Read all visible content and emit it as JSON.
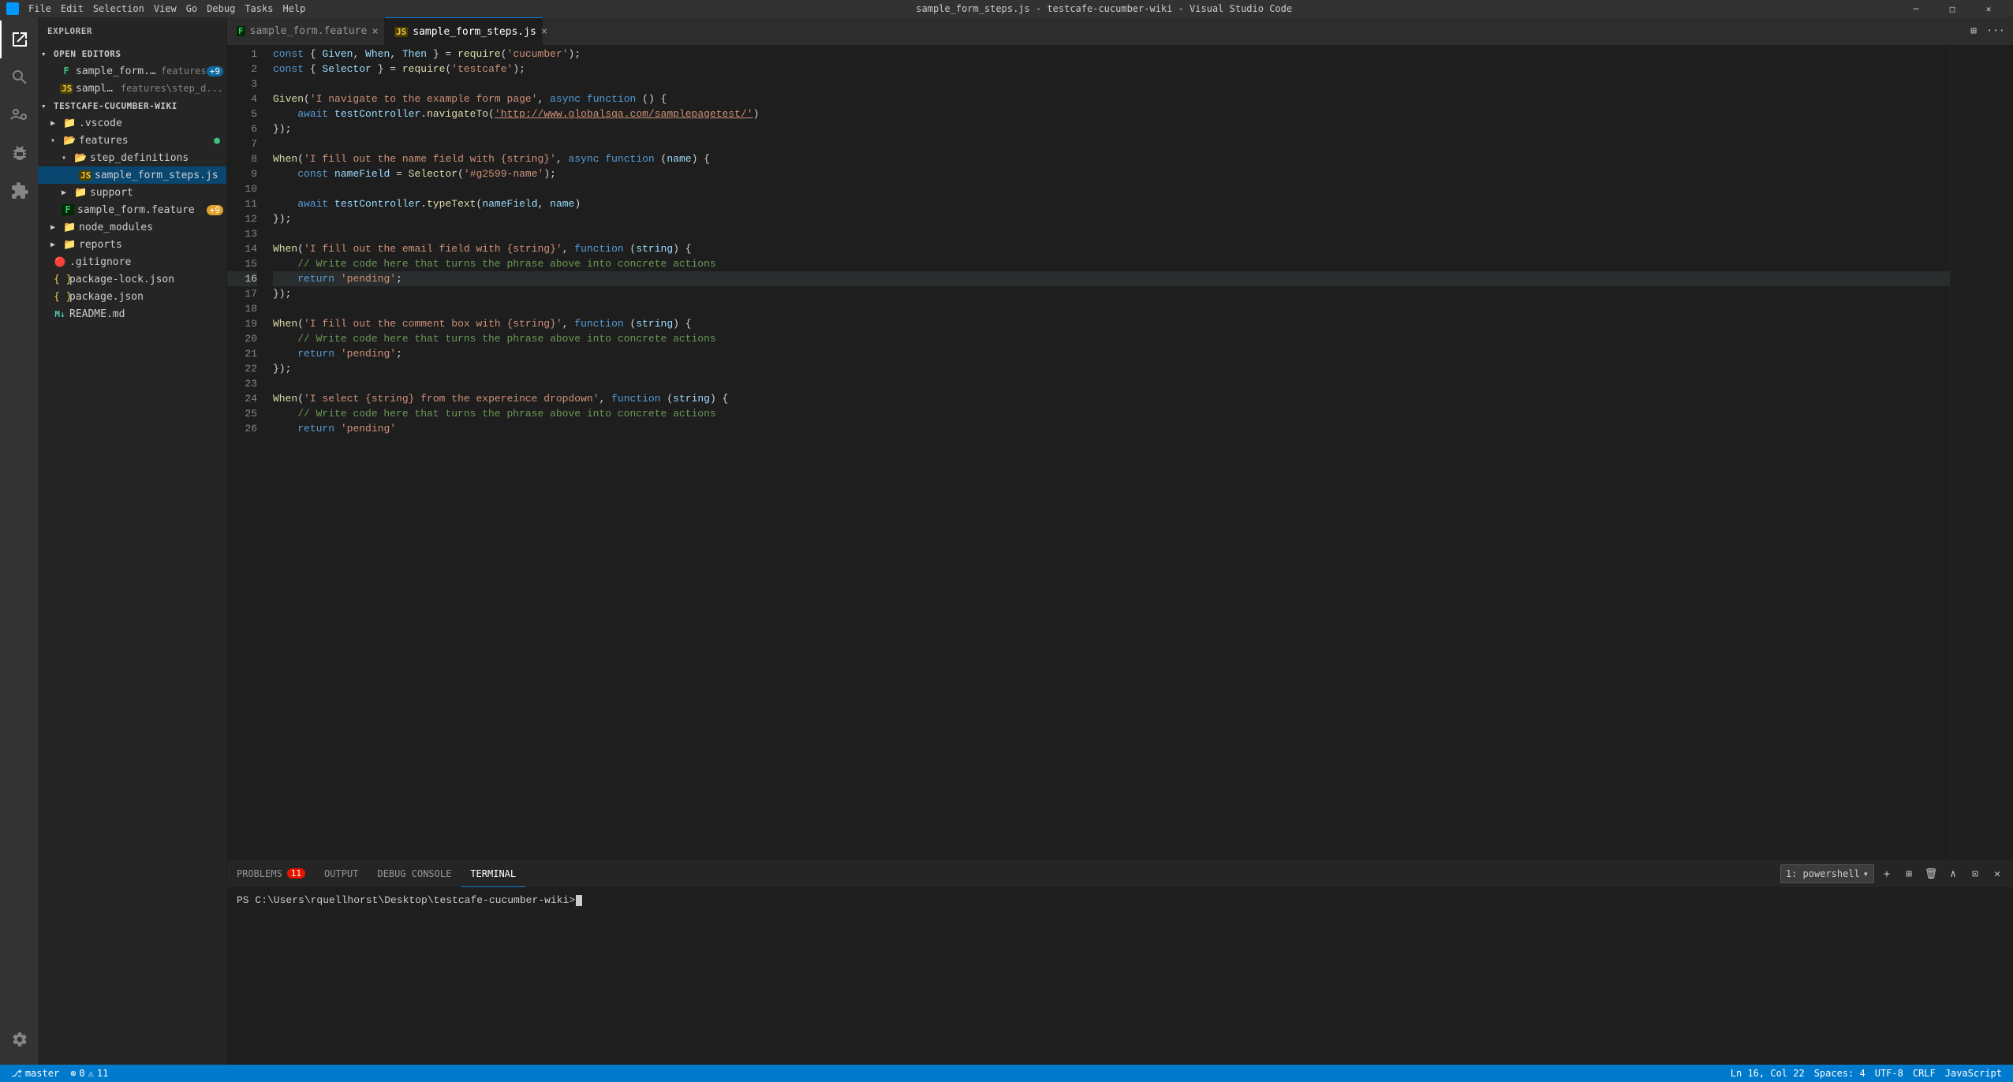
{
  "titlebar": {
    "title": "sample_form_steps.js - testcafe-cucumber-wiki - Visual Studio Code",
    "minimize": "─",
    "maximize": "□",
    "close": "✕"
  },
  "menubar": {
    "items": [
      "File",
      "Edit",
      "Selection",
      "View",
      "Go",
      "Debug",
      "Tasks",
      "Help"
    ]
  },
  "sidebar": {
    "title": "Explorer",
    "sections": {
      "open_editors": {
        "label": "Open Editors",
        "items": [
          {
            "name": "sample_form.feature",
            "icon": "feature",
            "color": "#3dc27a",
            "badge": "+9",
            "extra": "features"
          },
          {
            "name": "sample_form_steps.js",
            "icon": "js",
            "color": "#e8c84e",
            "extra": "features\\step_d..."
          }
        ]
      },
      "project": {
        "label": "TESTCAFE-CUCUMBER-WIKI",
        "items": [
          {
            "type": "folder",
            "name": ".vscode",
            "indent": 1,
            "color": "#e2b040"
          },
          {
            "type": "folder",
            "name": "features",
            "indent": 1,
            "color": "#3dc27a",
            "badge": "●"
          },
          {
            "type": "folder",
            "name": "step_definitions",
            "indent": 2,
            "color": ""
          },
          {
            "type": "file",
            "name": "sample_form_steps.js",
            "indent": 3,
            "color": "#e8c84e",
            "selected": true
          },
          {
            "type": "folder",
            "name": "support",
            "indent": 2,
            "color": ""
          },
          {
            "type": "file",
            "name": "sample_form.feature",
            "indent": 2,
            "color": "#3dc27a",
            "badge": "+9"
          },
          {
            "type": "folder",
            "name": "node_modules",
            "indent": 1,
            "color": ""
          },
          {
            "type": "folder",
            "name": "reports",
            "indent": 1,
            "color": ""
          },
          {
            "type": "file",
            "name": ".gitignore",
            "indent": 1,
            "color": "#e05252"
          },
          {
            "type": "file",
            "name": "package-lock.json",
            "indent": 1,
            "color": ""
          },
          {
            "type": "file",
            "name": "package.json",
            "indent": 1,
            "color": ""
          },
          {
            "type": "file",
            "name": "README.md",
            "indent": 1,
            "color": ""
          }
        ]
      }
    }
  },
  "tabs": [
    {
      "name": "sample_form.feature",
      "icon": "feature",
      "active": false,
      "modified": false
    },
    {
      "name": "sample_form_steps.js",
      "icon": "js",
      "active": true,
      "modified": false
    }
  ],
  "code": {
    "lines": [
      {
        "num": 1,
        "tokens": [
          {
            "t": "kw",
            "v": "const"
          },
          {
            "t": "plain",
            "v": " { "
          },
          {
            "t": "var",
            "v": "Given"
          },
          {
            "t": "plain",
            "v": ", "
          },
          {
            "t": "var",
            "v": "When"
          },
          {
            "t": "plain",
            "v": ", "
          },
          {
            "t": "var",
            "v": "Then"
          },
          {
            "t": "plain",
            "v": " } = "
          },
          {
            "t": "fn",
            "v": "require"
          },
          {
            "t": "plain",
            "v": "("
          },
          {
            "t": "str",
            "v": "'cucumber'"
          },
          {
            "t": "plain",
            "v": ");"
          }
        ]
      },
      {
        "num": 2,
        "tokens": [
          {
            "t": "kw",
            "v": "const"
          },
          {
            "t": "plain",
            "v": " { "
          },
          {
            "t": "var",
            "v": "Selector"
          },
          {
            "t": "plain",
            "v": " } = "
          },
          {
            "t": "fn",
            "v": "require"
          },
          {
            "t": "plain",
            "v": "("
          },
          {
            "t": "str",
            "v": "'testcafe'"
          },
          {
            "t": "plain",
            "v": ");"
          }
        ]
      },
      {
        "num": 3,
        "tokens": []
      },
      {
        "num": 4,
        "tokens": [
          {
            "t": "fn",
            "v": "Given"
          },
          {
            "t": "plain",
            "v": "("
          },
          {
            "t": "str",
            "v": "'I navigate to the example form page'"
          },
          {
            "t": "plain",
            "v": ", "
          },
          {
            "t": "kw",
            "v": "async"
          },
          {
            "t": "plain",
            "v": " "
          },
          {
            "t": "kw",
            "v": "function"
          },
          {
            "t": "plain",
            "v": " () {"
          }
        ]
      },
      {
        "num": 5,
        "tokens": [
          {
            "t": "plain",
            "v": "    "
          },
          {
            "t": "kw",
            "v": "await"
          },
          {
            "t": "plain",
            "v": " "
          },
          {
            "t": "var",
            "v": "testController"
          },
          {
            "t": "plain",
            "v": "."
          },
          {
            "t": "fn",
            "v": "navigateTo"
          },
          {
            "t": "plain",
            "v": "("
          },
          {
            "t": "url",
            "v": "'http://www.globalsqa.com/samplepagetest/'"
          },
          {
            "t": "plain",
            "v": ")"
          }
        ]
      },
      {
        "num": 6,
        "tokens": [
          {
            "t": "plain",
            "v": "});"
          }
        ]
      },
      {
        "num": 7,
        "tokens": []
      },
      {
        "num": 8,
        "tokens": [
          {
            "t": "fn",
            "v": "When"
          },
          {
            "t": "plain",
            "v": "("
          },
          {
            "t": "str",
            "v": "'I fill out the name field with {string}'"
          },
          {
            "t": "plain",
            "v": ", "
          },
          {
            "t": "kw",
            "v": "async"
          },
          {
            "t": "plain",
            "v": " "
          },
          {
            "t": "kw",
            "v": "function"
          },
          {
            "t": "plain",
            "v": " ("
          },
          {
            "t": "var",
            "v": "name"
          },
          {
            "t": "plain",
            "v": ") {"
          }
        ]
      },
      {
        "num": 9,
        "tokens": [
          {
            "t": "plain",
            "v": "    "
          },
          {
            "t": "kw",
            "v": "const"
          },
          {
            "t": "plain",
            "v": " "
          },
          {
            "t": "var",
            "v": "nameField"
          },
          {
            "t": "plain",
            "v": " = "
          },
          {
            "t": "fn",
            "v": "Selector"
          },
          {
            "t": "plain",
            "v": "("
          },
          {
            "t": "str",
            "v": "'#g2599-name'"
          },
          {
            "t": "plain",
            "v": ");"
          }
        ]
      },
      {
        "num": 10,
        "tokens": []
      },
      {
        "num": 11,
        "tokens": [
          {
            "t": "plain",
            "v": "    "
          },
          {
            "t": "kw",
            "v": "await"
          },
          {
            "t": "plain",
            "v": " "
          },
          {
            "t": "var",
            "v": "testController"
          },
          {
            "t": "plain",
            "v": "."
          },
          {
            "t": "fn",
            "v": "typeText"
          },
          {
            "t": "plain",
            "v": "("
          },
          {
            "t": "var",
            "v": "nameField"
          },
          {
            "t": "plain",
            "v": ", "
          },
          {
            "t": "var",
            "v": "name"
          },
          {
            "t": "plain",
            "v": ")"
          }
        ]
      },
      {
        "num": 12,
        "tokens": [
          {
            "t": "plain",
            "v": "});"
          }
        ]
      },
      {
        "num": 13,
        "tokens": []
      },
      {
        "num": 14,
        "tokens": [
          {
            "t": "fn",
            "v": "When"
          },
          {
            "t": "plain",
            "v": "("
          },
          {
            "t": "str",
            "v": "'I fill out the email field with {string}'"
          },
          {
            "t": "plain",
            "v": ", "
          },
          {
            "t": "kw",
            "v": "function"
          },
          {
            "t": "plain",
            "v": " ("
          },
          {
            "t": "var",
            "v": "string"
          },
          {
            "t": "plain",
            "v": ") {"
          }
        ]
      },
      {
        "num": 15,
        "tokens": [
          {
            "t": "plain",
            "v": "    "
          },
          {
            "t": "cm",
            "v": "// Write code here that turns the phrase above into concrete actions"
          }
        ]
      },
      {
        "num": 16,
        "tokens": [
          {
            "t": "plain",
            "v": "    "
          },
          {
            "t": "kw",
            "v": "return"
          },
          {
            "t": "plain",
            "v": " "
          },
          {
            "t": "str",
            "v": "'pending'"
          },
          {
            "t": "plain",
            "v": ";"
          }
        ],
        "highlighted": true
      },
      {
        "num": 17,
        "tokens": [
          {
            "t": "plain",
            "v": "});"
          }
        ]
      },
      {
        "num": 18,
        "tokens": []
      },
      {
        "num": 19,
        "tokens": [
          {
            "t": "fn",
            "v": "When"
          },
          {
            "t": "plain",
            "v": "("
          },
          {
            "t": "str",
            "v": "'I fill out the comment box with {string}'"
          },
          {
            "t": "plain",
            "v": ", "
          },
          {
            "t": "kw",
            "v": "function"
          },
          {
            "t": "plain",
            "v": " ("
          },
          {
            "t": "var",
            "v": "string"
          },
          {
            "t": "plain",
            "v": ") {"
          }
        ]
      },
      {
        "num": 20,
        "tokens": [
          {
            "t": "plain",
            "v": "    "
          },
          {
            "t": "cm",
            "v": "// Write code here that turns the phrase above into concrete actions"
          }
        ]
      },
      {
        "num": 21,
        "tokens": [
          {
            "t": "plain",
            "v": "    "
          },
          {
            "t": "kw",
            "v": "return"
          },
          {
            "t": "plain",
            "v": " "
          },
          {
            "t": "str",
            "v": "'pending'"
          },
          {
            "t": "plain",
            "v": ";"
          }
        ]
      },
      {
        "num": 22,
        "tokens": [
          {
            "t": "plain",
            "v": "});"
          }
        ]
      },
      {
        "num": 23,
        "tokens": []
      },
      {
        "num": 24,
        "tokens": [
          {
            "t": "fn",
            "v": "When"
          },
          {
            "t": "plain",
            "v": "("
          },
          {
            "t": "str",
            "v": "'I select {string} from the expereince dropdown'"
          },
          {
            "t": "plain",
            "v": ", "
          },
          {
            "t": "kw",
            "v": "function"
          },
          {
            "t": "plain",
            "v": " ("
          },
          {
            "t": "var",
            "v": "string"
          },
          {
            "t": "plain",
            "v": ") {"
          }
        ]
      },
      {
        "num": 25,
        "tokens": [
          {
            "t": "plain",
            "v": "    "
          },
          {
            "t": "cm",
            "v": "// Write code here that turns the phrase above into concrete actions"
          }
        ]
      },
      {
        "num": 26,
        "tokens": [
          {
            "t": "plain",
            "v": "    "
          },
          {
            "t": "kw",
            "v": "return"
          },
          {
            "t": "plain",
            "v": " "
          },
          {
            "t": "str",
            "v": "'pending'"
          }
        ]
      }
    ]
  },
  "panel": {
    "tabs": [
      {
        "name": "PROBLEMS",
        "badge": "11",
        "active": false
      },
      {
        "name": "OUTPUT",
        "badge": null,
        "active": false
      },
      {
        "name": "DEBUG CONSOLE",
        "badge": null,
        "active": false
      },
      {
        "name": "TERMINAL",
        "badge": null,
        "active": true
      }
    ],
    "terminal": {
      "prompt": "PS C:\\Users\\rquellhorst\\Desktop\\testcafe-cucumber-wiki>",
      "selector": "1: powershell"
    }
  },
  "statusbar": {
    "left": [
      {
        "icon": "git-branch",
        "label": "⓪ 0"
      },
      {
        "icon": "warning",
        "label": "⚠ 11"
      }
    ],
    "right": [
      {
        "label": "Ln 16, Col 22"
      },
      {
        "label": "Spaces: 4"
      },
      {
        "label": "UTF-8"
      },
      {
        "label": "CRLF"
      },
      {
        "label": "JavaScript"
      }
    ]
  }
}
